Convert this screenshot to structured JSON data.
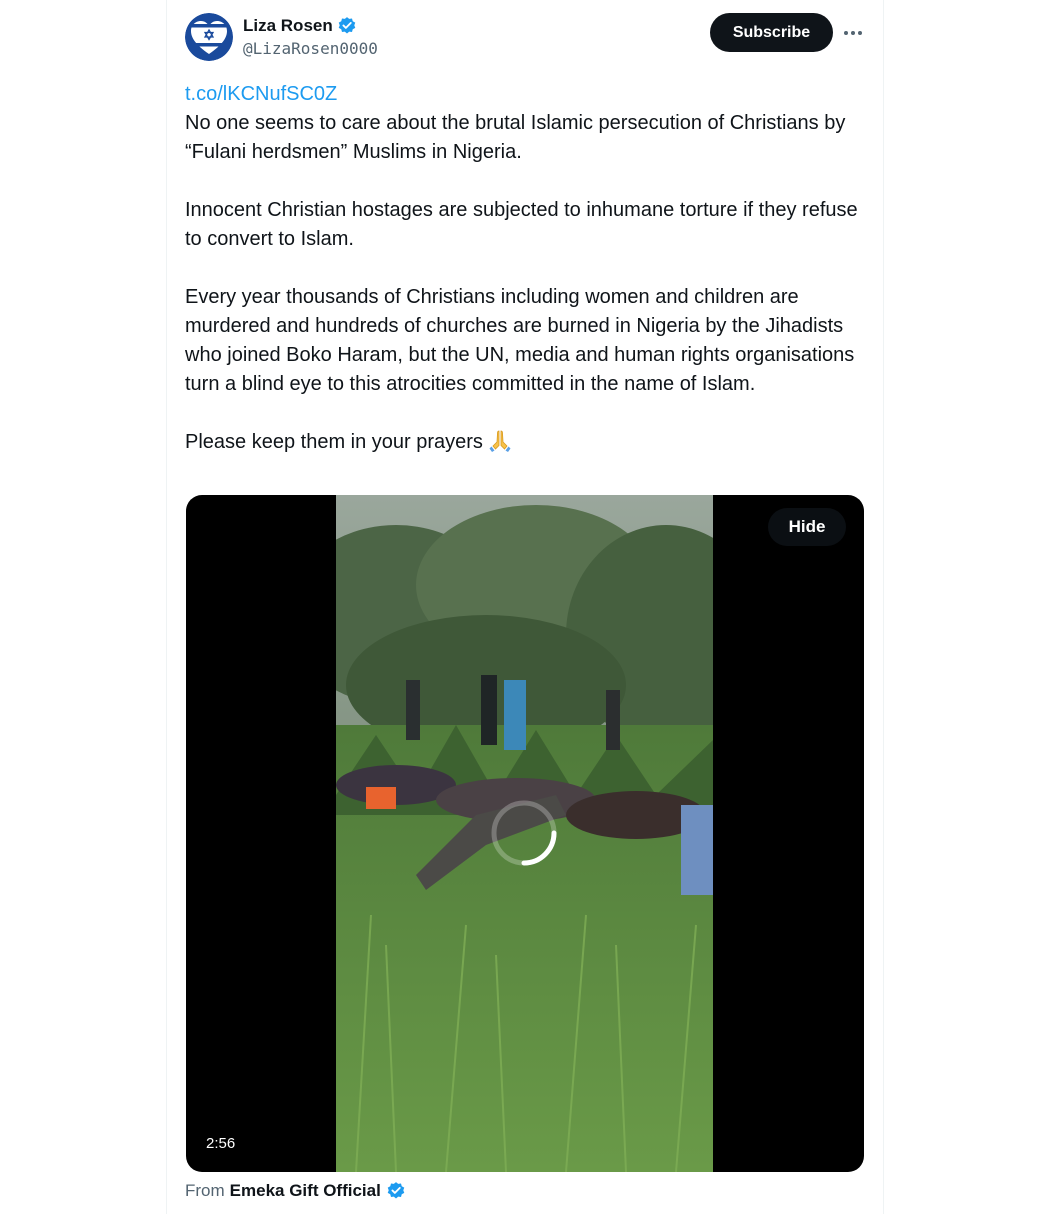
{
  "author": {
    "name": "Liza Rosen",
    "handle": "@LizaRosen0000",
    "verified": true,
    "avatar_icon": "israel-flag-heart-avatar"
  },
  "actions": {
    "subscribe_label": "Subscribe",
    "more_icon": "more-horizontal-icon"
  },
  "tweet": {
    "link": "t.co/lKCNufSC0Z",
    "paragraphs": [
      "No one seems to care about the brutal Islamic persecution of Christians by “Fulani herdsmen” Muslims in Nigeria.",
      "Innocent Christian hostages are subjected to inhumane torture if they refuse to convert to Islam.",
      "Every year thousands of Christians including women and children are murdered and hundreds of churches are burned in Nigeria by the Jihadists who joined Boko Haram, but the UN, media and human rights organisations turn a blind eye to this atrocities committed in the name of Islam.",
      "Please keep them in your prayers"
    ],
    "emoji": "folded-hands-emoji"
  },
  "media": {
    "hide_label": "Hide",
    "duration": "2:56",
    "state": "loading"
  },
  "source": {
    "prefix": "From",
    "account": "Emeka Gift Official",
    "verified": true
  },
  "colors": {
    "link": "#1d9bf0",
    "verified": "#1d9bf0",
    "text": "#0f1419",
    "secondary": "#536471",
    "button_dark": "#0f1419"
  }
}
